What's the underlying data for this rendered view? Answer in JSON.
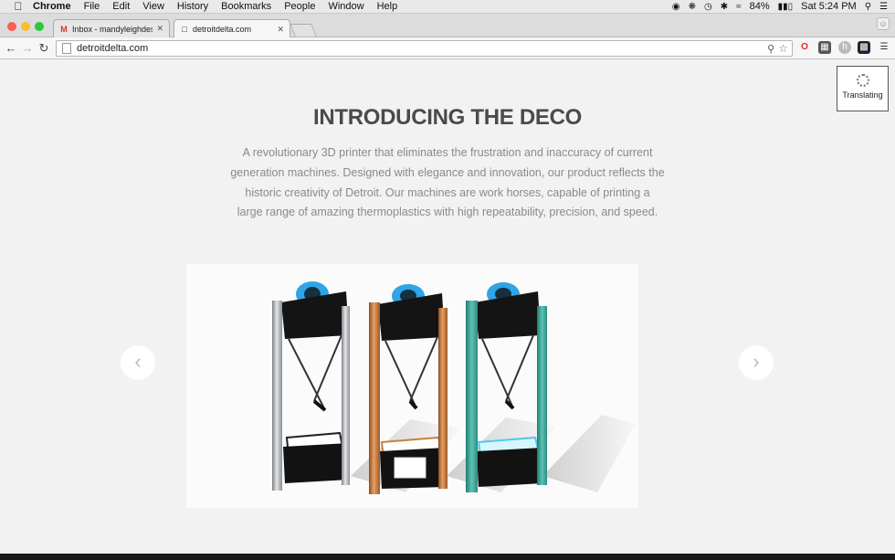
{
  "menubar": {
    "app": "Chrome",
    "items": [
      "File",
      "Edit",
      "View",
      "History",
      "Bookmarks",
      "People",
      "Window",
      "Help"
    ],
    "battery": "84%",
    "clock": "Sat 5:24 PM",
    "icons": [
      "apple-icon",
      "creative-cloud-icon",
      "bluetooth-icon",
      "wifi-icon",
      "battery-icon",
      "spotlight-icon",
      "notification-center-icon"
    ]
  },
  "tabs": [
    {
      "label": "Inbox - mandyleighdesign",
      "favicon": "gmail-icon",
      "active": false
    },
    {
      "label": "detroitdelta.com",
      "favicon": "page-icon",
      "active": true
    }
  ],
  "toolbar": {
    "url": "detroitdelta.com"
  },
  "translate_popup": {
    "label": "Translating"
  },
  "hero": {
    "title": "INTRODUCING THE DECO",
    "description_lines": [
      "A revolutionary 3D printer that eliminates the frustration and inaccuracy of current",
      "generation machines. Designed with elegance and innovation, our product reflects the",
      "historic creativity of Detroit. Our machines are work horses, capable of printing a",
      "large range of amazing thermoplastics with high repeatability, precision, and speed."
    ]
  },
  "carousel": {
    "prev_glyph": "‹",
    "next_glyph": "›",
    "printer_finishes": [
      "#b9bcc0",
      "#c88140",
      "#3fa59a"
    ]
  },
  "colors": {
    "accent_blue": "#2fa4e7",
    "title_gray": "#4a4a4a",
    "body_gray": "#8a8a8a"
  }
}
